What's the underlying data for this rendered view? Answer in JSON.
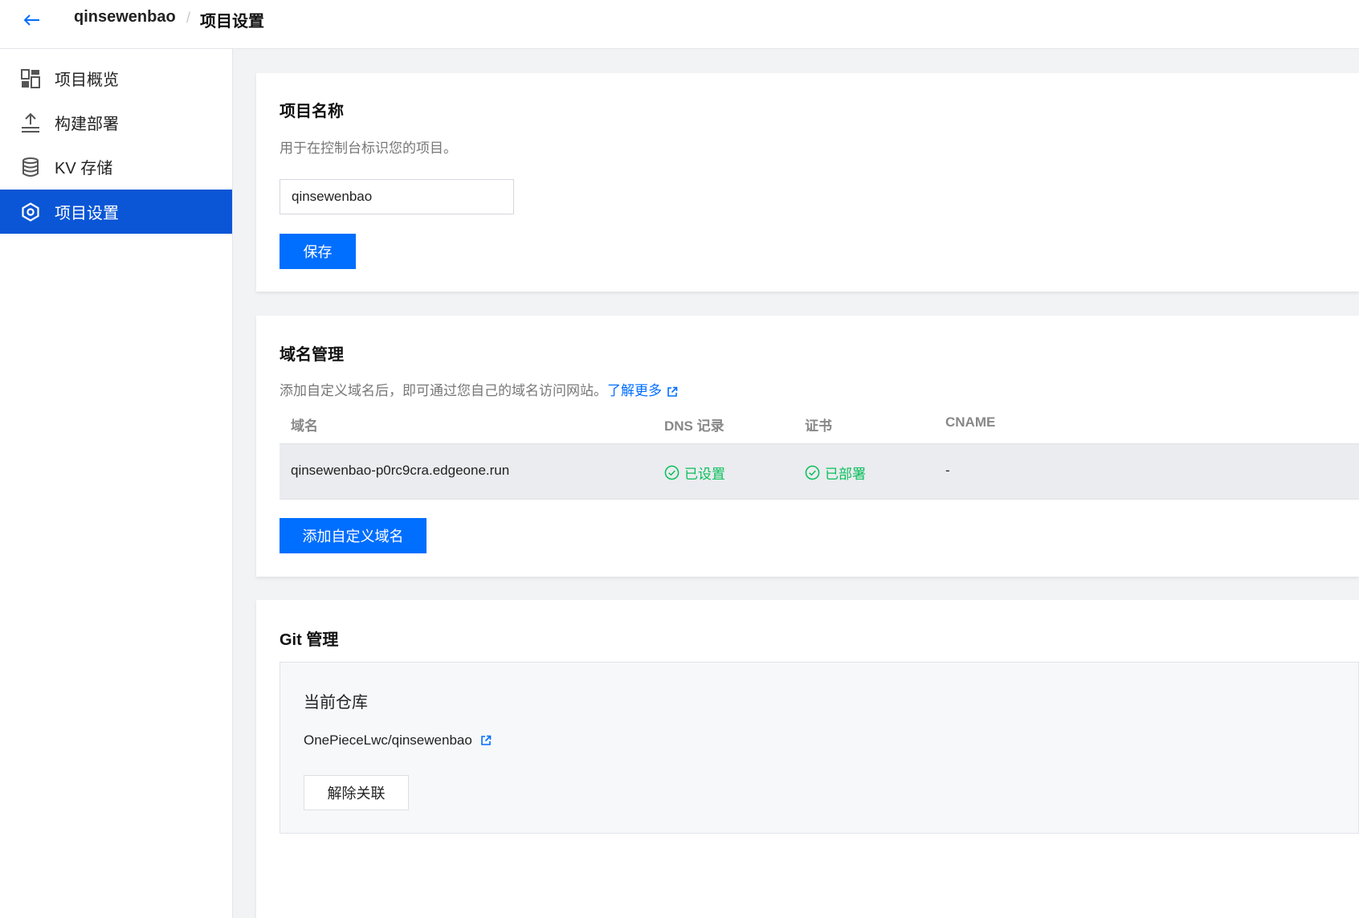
{
  "header": {
    "back_icon": "arrow-left-icon",
    "project_name": "qinsewenbao",
    "separator": "/",
    "current_page": "项目设置"
  },
  "sidebar": {
    "items": [
      {
        "label": "项目概览",
        "icon": "dashboard-icon",
        "active": false
      },
      {
        "label": "构建部署",
        "icon": "upload-icon",
        "active": false
      },
      {
        "label": "KV 存储",
        "icon": "database-icon",
        "active": false
      },
      {
        "label": "项目设置",
        "icon": "settings-hexagon-icon",
        "active": true
      }
    ]
  },
  "project_name_card": {
    "title": "项目名称",
    "description": "用于在控制台标识您的项目。",
    "input_value": "qinsewenbao",
    "save_label": "保存"
  },
  "domain_card": {
    "title": "域名管理",
    "description": "添加自定义域名后，即可通过您自己的域名访问网站。",
    "learn_more": "了解更多",
    "columns": [
      "域名",
      "DNS 记录",
      "证书",
      "CNAME"
    ],
    "rows": [
      {
        "domain": "qinsewenbao-p0rc9cra.edgeone.run",
        "dns": "已设置",
        "cert": "已部署",
        "cname": "-"
      }
    ],
    "add_label": "添加自定义域名"
  },
  "git_card": {
    "title": "Git 管理",
    "repo_title": "当前仓库",
    "repo_name": "OnePieceLwc/qinsewenbao",
    "unlink_label": "解除关联"
  },
  "colors": {
    "primary": "#006eff",
    "nav_active": "#0a56d6",
    "success": "#0abf5b",
    "page_bg": "#f2f3f5"
  }
}
